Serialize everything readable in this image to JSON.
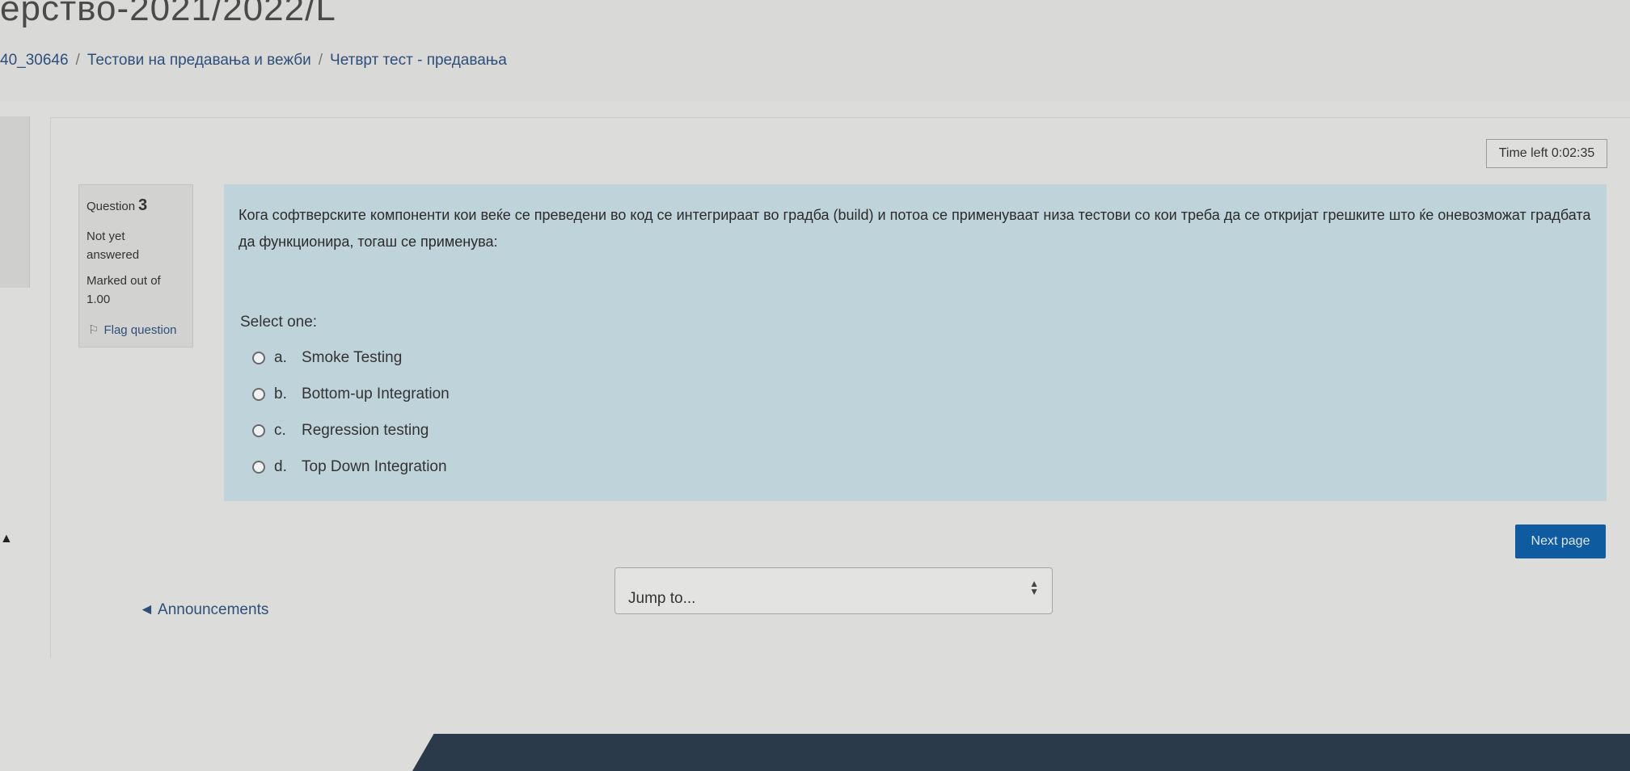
{
  "header": {
    "course_title": "ерство-2021/2022/L",
    "breadcrumb": [
      "40_30646",
      "Тестови на предавања и вежби",
      "Четврт тест - предавања"
    ]
  },
  "timer": {
    "text": "Time left 0:02:35"
  },
  "question_info": {
    "label": "Question",
    "number": "3",
    "state": "Not yet answered",
    "marked_out_of": "Marked out of 1.00",
    "flag_label": "Flag question",
    "flag_icon": "flag-icon"
  },
  "question": {
    "text": "Кога софтверските компоненти кои веќе се преведени во код се интегрираат во градба (build) и потоа се применуваат низа тестови со кои треба да се откријат грешките што ќе оневозможат градбата да функционира, тогаш се применува:",
    "prompt": "Select one:",
    "options": [
      {
        "letter": "a.",
        "text": "Smoke Testing"
      },
      {
        "letter": "b.",
        "text": "Bottom-up Integration"
      },
      {
        "letter": "c.",
        "text": "Regression testing"
      },
      {
        "letter": "d.",
        "text": "Top Down Integration"
      }
    ]
  },
  "navigation": {
    "next_label": "Next page",
    "prev_activity": "◄ Announcements",
    "jump_placeholder": "Jump to..."
  },
  "colors": {
    "question_bg": "#bfd3da",
    "button_bg": "#0f5b9f",
    "link": "#2e4f7a"
  }
}
